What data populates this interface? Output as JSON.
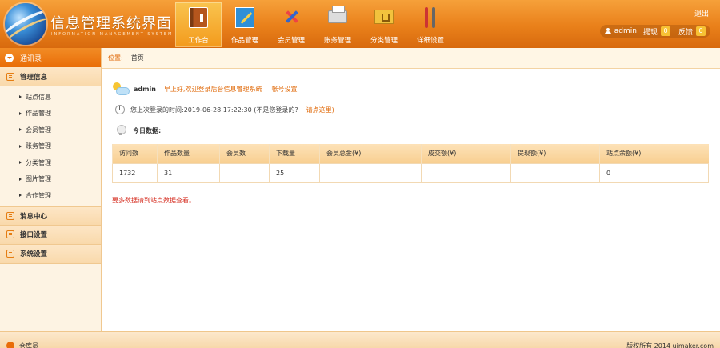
{
  "header": {
    "title": "信息管理系统界面",
    "subtitle": "INFORMATION MANAGEMENT SYSTEM BOX",
    "logout": "退出",
    "nav": [
      {
        "label": "工作台",
        "icon": "book-icon",
        "active": true
      },
      {
        "label": "作品管理",
        "icon": "pencil-icon",
        "active": false
      },
      {
        "label": "会员管理",
        "icon": "tools-icon",
        "active": false
      },
      {
        "label": "账务管理",
        "icon": "printer-icon",
        "active": false
      },
      {
        "label": "分类管理",
        "icon": "folder-icon",
        "active": false
      },
      {
        "label": "详细设置",
        "icon": "screwdriver-icon",
        "active": false
      }
    ],
    "user": {
      "name": "admin",
      "withdraw_label": "提现",
      "withdraw_count": "0",
      "feedback_label": "反馈",
      "feedback_count": "0"
    }
  },
  "sidebar": {
    "top_label": "通讯录",
    "section_manage": "管理信息",
    "items": [
      "站点信息",
      "作品管理",
      "会员管理",
      "账务管理",
      "分类管理",
      "图片管理",
      "合作管理"
    ],
    "section_message": "消息中心",
    "section_api": "接口设置",
    "section_system": "系统设置"
  },
  "breadcrumb": {
    "label": "位置:",
    "current": "首页"
  },
  "main": {
    "admin_name": "admin",
    "welcome": "早上好,欢迎登录后台信息管理系统",
    "account_settings": "帐号设置",
    "last_login": "您上次登录的时间:2019-06-28 17:22:30 (不是您登录的?",
    "report_link": "请点这里)",
    "today_title": "今日数据:",
    "table": {
      "headers": [
        "访问数",
        "作品数量",
        "会员数",
        "下载量",
        "会员总金(¥)",
        "成交额(¥)",
        "提现额(¥)",
        "站点余额(¥)"
      ],
      "row": [
        "1732",
        "31",
        "",
        "25",
        "",
        "",
        "",
        "0"
      ]
    },
    "more_data": "要多数据请到站点数据查看。"
  },
  "footer": {
    "left": "仓库员",
    "right": "版权所有 2014 uimaker.com"
  }
}
